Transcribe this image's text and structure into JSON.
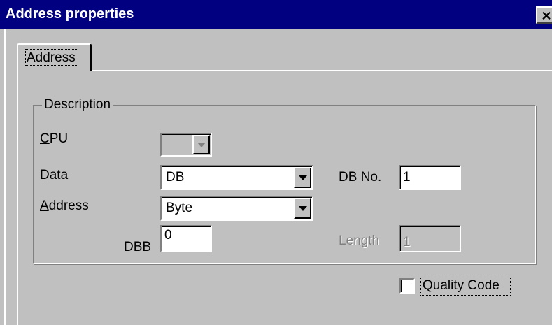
{
  "window": {
    "title": "Address properties",
    "close_glyph": "✕"
  },
  "tabs": [
    {
      "label": "Address",
      "selected": true
    }
  ],
  "group": {
    "label": "Description"
  },
  "fields": {
    "cpu": {
      "label_first": "C",
      "label_rest": "PU",
      "value": ""
    },
    "data": {
      "label_first": "D",
      "label_rest": "ata",
      "value": "DB"
    },
    "address": {
      "label_first": "A",
      "label_rest": "ddress",
      "value": "Byte"
    },
    "db_no": {
      "label_pre": "D",
      "label_u": "B",
      "label_post": " No.",
      "value": "1"
    },
    "dbb": {
      "label": "DBB",
      "value": "0"
    },
    "length": {
      "label": "Length",
      "value": "1"
    }
  },
  "quality_code": {
    "label": "Quality Code",
    "checked": false
  },
  "icons": {
    "dropdown": "chevron-down-icon",
    "close": "close-icon"
  },
  "colors": {
    "titlebar": "#000080",
    "face": "#c0c0c0",
    "field": "#ffffff",
    "disabled_text": "#808080"
  }
}
